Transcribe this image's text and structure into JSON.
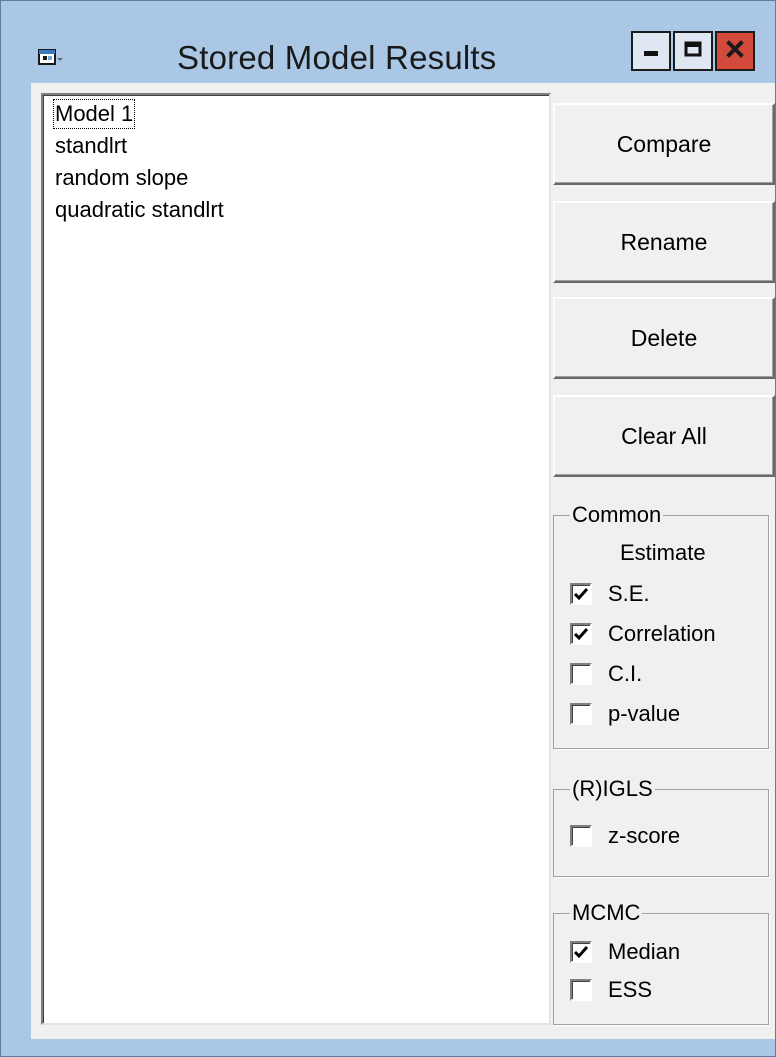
{
  "window": {
    "title": "Stored Model Results",
    "app_icon": "window-app-icon",
    "controls": {
      "minimize_icon": "minimize-icon",
      "maximize_icon": "maximize-icon",
      "close_icon": "close-icon"
    }
  },
  "models_list": {
    "items": [
      "Model 1",
      "standlrt",
      "random slope",
      "quadratic standlrt"
    ],
    "focused_index": 0
  },
  "buttons": {
    "compare": "Compare",
    "rename": "Rename",
    "delete": "Delete",
    "clear_all": "Clear All"
  },
  "common_group": {
    "label": "Common",
    "estimate_label": "Estimate",
    "options": [
      {
        "label": "S.E.",
        "checked": true
      },
      {
        "label": "Correlation",
        "checked": true
      },
      {
        "label": "C.I.",
        "checked": false
      },
      {
        "label": "p-value",
        "checked": false
      }
    ]
  },
  "rigls_group": {
    "label": "(R)IGLS",
    "options": [
      {
        "label": "z-score",
        "checked": false
      }
    ]
  },
  "mcmc_group": {
    "label": "MCMC",
    "options": [
      {
        "label": "Median",
        "checked": true
      },
      {
        "label": "ESS",
        "checked": false
      }
    ]
  },
  "colors": {
    "title_bar": "#aac8e6",
    "close_button": "#d44a3a",
    "dialog_background": "#f0f0f0"
  }
}
